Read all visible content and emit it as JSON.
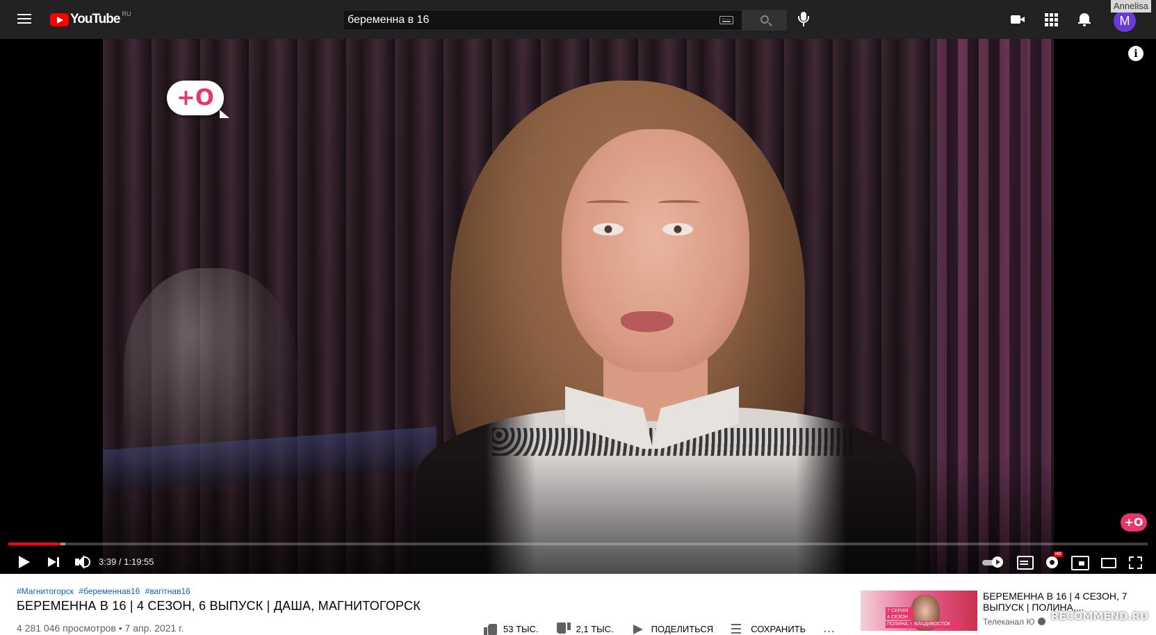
{
  "masthead": {
    "logo_text": "YouTube",
    "logo_region": "RU",
    "search_value": "беременна в 16",
    "user_initial": "M",
    "user_tag": "Annelisa"
  },
  "player": {
    "channel_logo_text": "+O",
    "watermark_text": "+O",
    "info_glyph": "i",
    "current_time": "3:39",
    "duration": "1:19:55",
    "time_display": "3:39 / 1:19:55",
    "progress_played_fraction": 0.046,
    "progress_loaded_fraction": 0.05,
    "autoplay": "on",
    "hd_badge": "HD"
  },
  "video": {
    "hashtags": [
      "#Магнитогорск",
      "#беременнав16",
      "#вагітнав16"
    ],
    "title": "БЕРЕМЕННА В 16 | 4 СЕЗОН, 6 ВЫПУСК | ДАША, МАГНИТОГОРСК",
    "meta": "4 281 046 просмотров • 7 апр. 2021 г.",
    "actions": {
      "like": "53 ТЫС.",
      "dislike": "2,1 ТЫС.",
      "share": "ПОДЕЛИТЬСЯ",
      "save": "СОХРАНИТЬ",
      "more": "..."
    }
  },
  "recommendation": {
    "title": "БЕРЕМЕННА В 16 | 4 СЕЗОН, 7 ВЫПУСК | ПОЛИНА,...",
    "channel": "Телеканал Ю",
    "thumb_tag": "7 СЕРИЯ 4 СЕЗОН",
    "thumb_city": "ПОЛИНА, г. ВЛАДИВОСТОК"
  },
  "site_watermark": "RECOMMEND.RU",
  "colors": {
    "masthead_bg": "#212121",
    "progress_red": "#ff0000",
    "channel_pink": "#e8356c",
    "link_blue": "#065fd4",
    "avatar_purple": "#6a3ad8"
  },
  "icons": [
    "menu-icon",
    "youtube-logo",
    "keyboard-icon",
    "search-icon",
    "mic-icon",
    "create-video-icon",
    "apps-icon",
    "bell-icon",
    "info-icon",
    "play-icon",
    "next-icon",
    "volume-icon",
    "autoplay-toggle",
    "subtitles-icon",
    "settings-icon",
    "miniplayer-icon",
    "theater-icon",
    "fullscreen-icon",
    "like-icon",
    "dislike-icon",
    "share-icon",
    "save-icon",
    "more-icon",
    "verified-icon"
  ]
}
